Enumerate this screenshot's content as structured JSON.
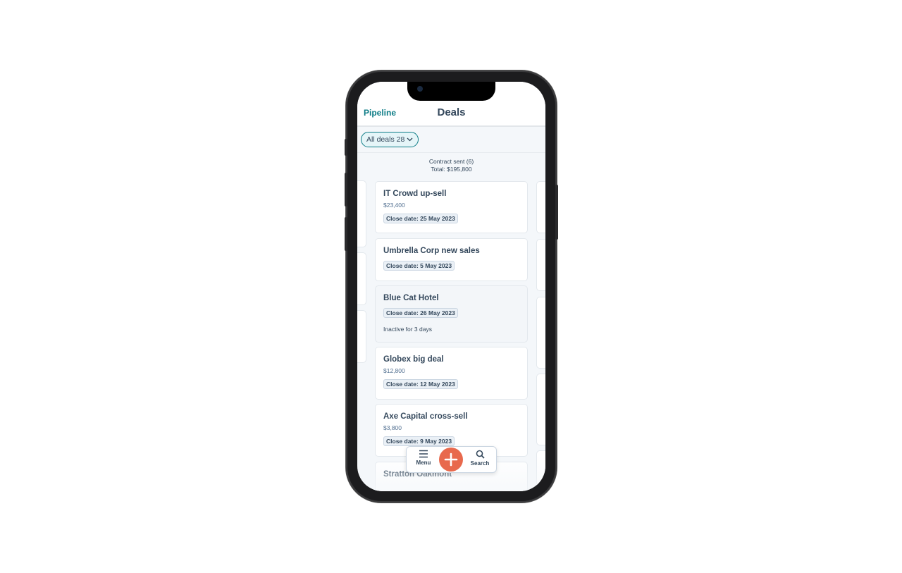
{
  "header": {
    "back_label": "Pipeline",
    "title": "Deals"
  },
  "filter": {
    "label": "All deals 28"
  },
  "stage": {
    "name": "Contract sent (6)",
    "total": "Total: $195,800"
  },
  "deals": [
    {
      "name": "IT Crowd up-sell",
      "amount": "$23,400",
      "close_date": "Close date: 25 May 2023"
    },
    {
      "name": "Umbrella Corp new sales",
      "close_date": "Close date: 5 May 2023"
    },
    {
      "name": "Blue Cat Hotel",
      "close_date": "Close date: 26 May 2023",
      "note": "Inactive for 3 days"
    },
    {
      "name": "Globex big deal",
      "amount": "$12,800",
      "close_date": "Close date: 12 May 2023"
    },
    {
      "name": "Axe Capital cross-sell",
      "amount": "$3,800",
      "close_date": "Close date: 9 May 2023"
    },
    {
      "name": "Stratton Oakmont"
    }
  ],
  "bottom_nav": {
    "menu_label": "Menu",
    "search_label": "Search"
  },
  "colors": {
    "accent": "#0d7c86",
    "fab": "#e8694d",
    "text": "#33475b"
  }
}
